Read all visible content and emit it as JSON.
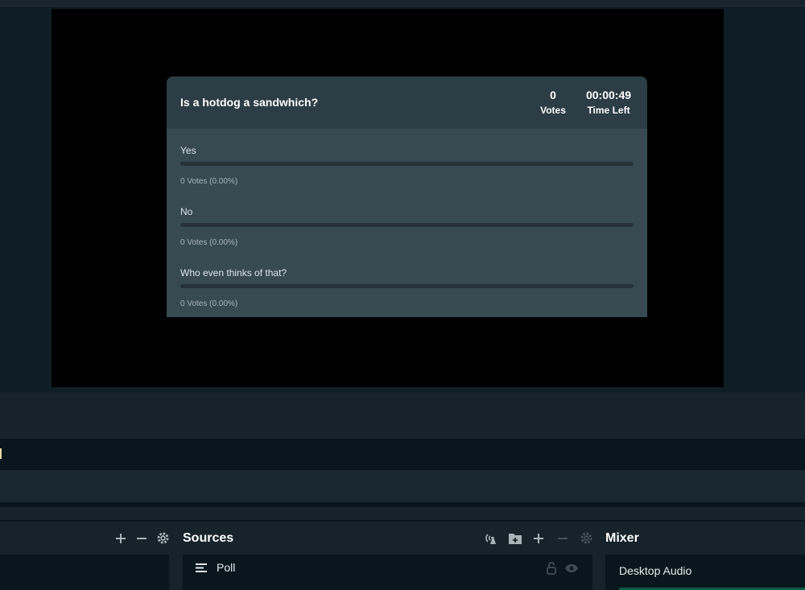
{
  "poll": {
    "question": "Is a hotdog a sandwhich?",
    "votes_value": "0",
    "votes_label": "Votes",
    "time_value": "00:00:49",
    "time_label": "Time Left",
    "options": [
      {
        "label": "Yes",
        "count": "0 Votes (0.00%)",
        "percent": 0
      },
      {
        "label": "No",
        "count": "0 Votes (0.00%)",
        "percent": 0
      },
      {
        "label": "Who even thinks of that?",
        "count": "0 Votes (0.00%)",
        "percent": 0
      }
    ]
  },
  "scenes": {
    "icons": [
      "plus-icon",
      "minus-icon",
      "gear-icon"
    ]
  },
  "sources": {
    "title": "Sources",
    "icons": [
      "broadcast-icon",
      "folder-add-icon",
      "plus-icon",
      "minus-icon",
      "gear-icon"
    ],
    "items": [
      {
        "label": "Poll",
        "icons": [
          "list-icon",
          "lock-icon",
          "eye-icon"
        ]
      }
    ]
  },
  "mixer": {
    "title": "Mixer",
    "items": [
      {
        "label": "Desktop Audio"
      }
    ]
  },
  "colors": {
    "background": "#09161d",
    "panel": "#17232b",
    "poll_header": "#2d3d45",
    "poll_body": "#374a52",
    "meter": "#0d5a45"
  }
}
